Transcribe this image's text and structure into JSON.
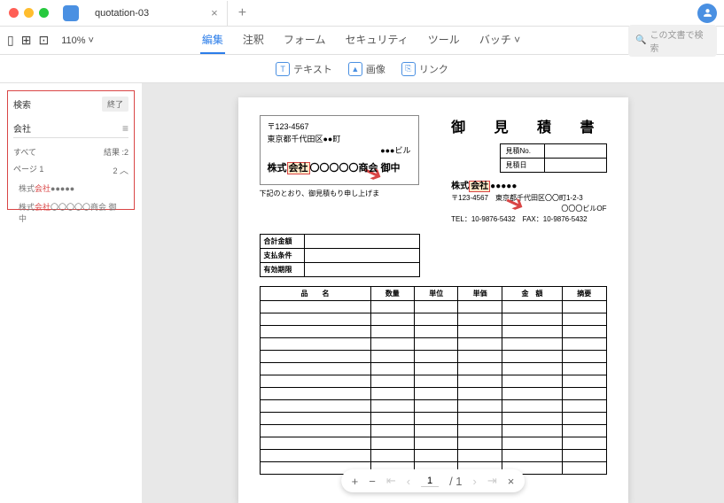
{
  "tab": {
    "title": "quotation-03"
  },
  "zoom": "110% ˅",
  "menus": {
    "edit": "編集",
    "annot": "注釈",
    "form": "フォーム",
    "security": "セキュリティ",
    "tool": "ツール",
    "batch": "バッチ ˅"
  },
  "search_placeholder": "この文書で検索",
  "sub": {
    "text": "テキスト",
    "image": "画像",
    "link": "リンク"
  },
  "sidebar": {
    "search": "検索",
    "end": "終了",
    "query": "会社",
    "all": "すべて",
    "all_count": "結果 :2",
    "page": "ページ 1",
    "page_count": "2",
    "r1a": "株式",
    "r1b": "会社",
    "r1c": "●●●●●",
    "r2a": "株式",
    "r2b": "会社",
    "r2c": "〇〇〇〇〇商会 御中"
  },
  "doc": {
    "zip": "〒123-4567",
    "addr": "東京都千代田区●●町",
    "bldg": "●●●ビル",
    "co_pre": "株式",
    "co_hl": "会社",
    "co_post": "〇〇〇〇〇商会",
    "co_suf": "御中",
    "title": "御 見 積 書",
    "meta1": "見積No.",
    "meta2": "見積日",
    "s_pre": "株式",
    "s_hl": "会社",
    "s_post": "●●●●●",
    "s_zip": "〒123-4567",
    "s_addr": "東京都千代田区〇〇町1-2-3",
    "s_bldg": "〇〇〇ビルOF",
    "s_tel": "TEL：10-9876-5432　FAX：10-9876-5432",
    "note": "下記のとおり、御見積もり申し上げま",
    "sum1": "合計金額",
    "sum2": "支払条件",
    "sum3": "有効期限",
    "h1": "品　　名",
    "h2": "数量",
    "h3": "単位",
    "h4": "単価",
    "h5": "金　額",
    "h6": "摘要"
  },
  "pagectl": {
    "cur": "1",
    "total": "/  1"
  }
}
